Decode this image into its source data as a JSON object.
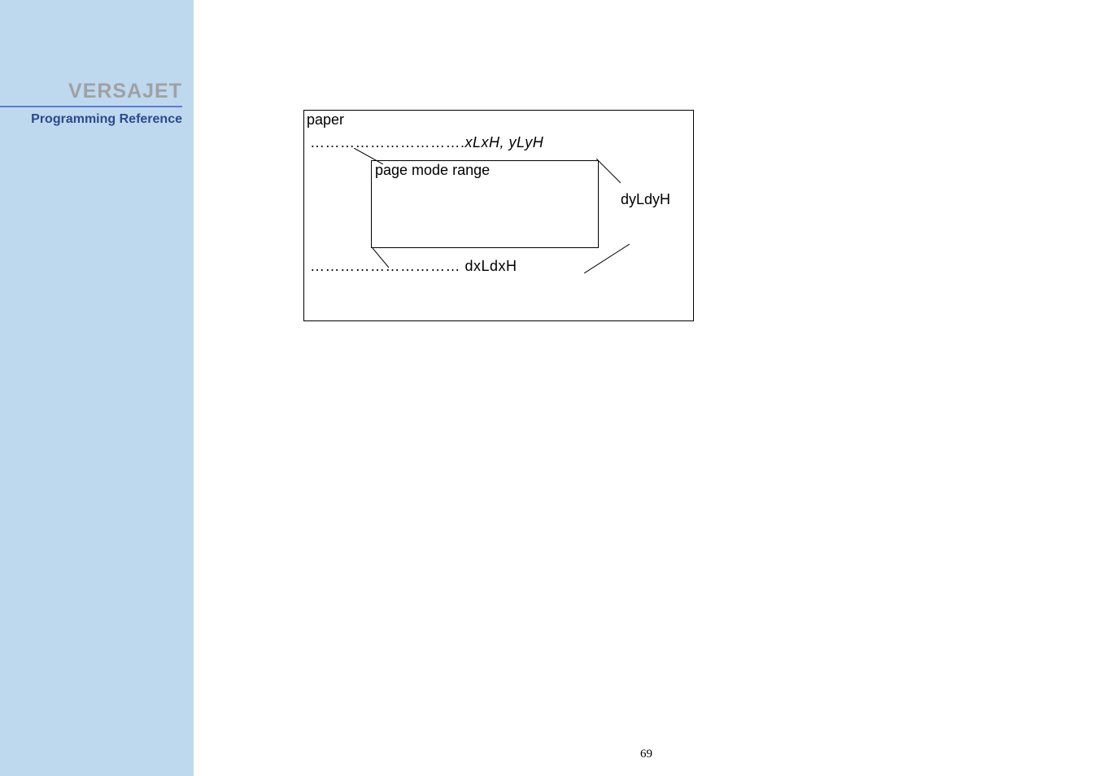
{
  "sidebar": {
    "brand": "VERSAJET",
    "subtitle": "Programming Reference"
  },
  "diagram": {
    "paper_label": "paper",
    "top_dots": "………………………….",
    "top_coord": "xLxH, yLyH",
    "range_label": "page mode range",
    "bottom_dots": "…………………………",
    "bottom_coord": "dxLdxH",
    "right_coord": "dyLdyH"
  },
  "page_number": "69"
}
